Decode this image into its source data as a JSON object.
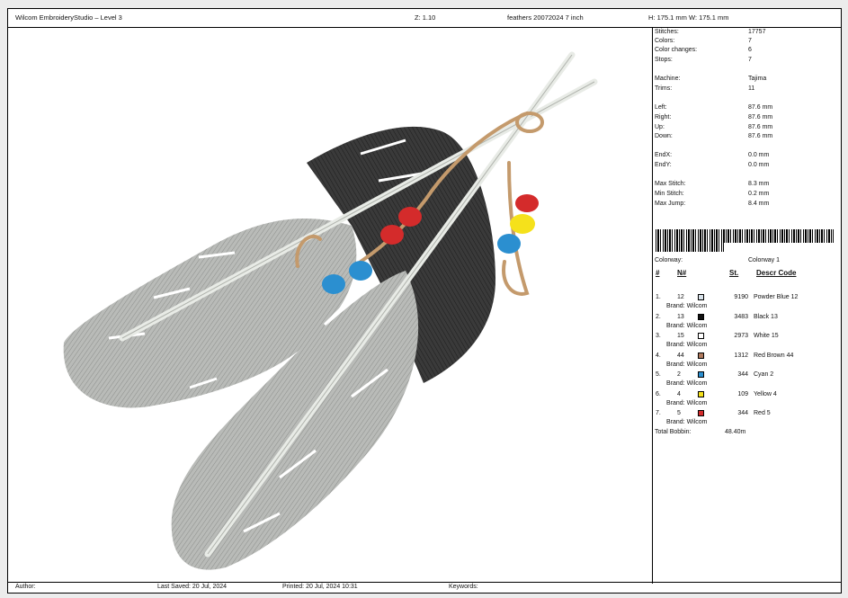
{
  "header": {
    "app_title": "Wilcom EmbroideryStudio – Level 3",
    "zoom": "Z: 1.10",
    "design_name": "feathers 20072024 7 inch",
    "size": "H: 175.1 mm   W: 175.1 mm"
  },
  "stats": {
    "stitches": {
      "label": "Stitches:",
      "value": "17757"
    },
    "colors": {
      "label": "Colors:",
      "value": "7"
    },
    "color_changes": {
      "label": "Color changes:",
      "value": "6"
    },
    "stops": {
      "label": "Stops:",
      "value": "7"
    },
    "machine": {
      "label": "Machine:",
      "value": "Tajima"
    },
    "trims": {
      "label": "Trims:",
      "value": "11"
    },
    "left": {
      "label": "Left:",
      "value": "87.6 mm"
    },
    "right": {
      "label": "Right:",
      "value": "87.6 mm"
    },
    "up": {
      "label": "Up:",
      "value": "87.6 mm"
    },
    "down": {
      "label": "Down:",
      "value": "87.6 mm"
    },
    "endx": {
      "label": "EndX:",
      "value": "0.0 mm"
    },
    "endy": {
      "label": "EndY:",
      "value": "0.0 mm"
    },
    "max_stitch": {
      "label": "Max Stitch:",
      "value": "8.3 mm"
    },
    "min_stitch": {
      "label": "Min Stitch:",
      "value": "0.2 mm"
    },
    "max_jump": {
      "label": "Max Jump:",
      "value": "8.4 mm"
    }
  },
  "colorway": {
    "label": "Colorway:",
    "value": "Colorway 1"
  },
  "table": {
    "col_num": "#",
    "col_n": "N#",
    "col_st": "St.",
    "col_descr": "Descr  Code",
    "rows": [
      {
        "idx": "1.",
        "n": "12",
        "color": "#d8e2ea",
        "st": "9190",
        "descr": "Powder Blue 12",
        "brand": "Brand: Wilcom"
      },
      {
        "idx": "2.",
        "n": "13",
        "color": "#111111",
        "st": "3483",
        "descr": "Black 13",
        "brand": "Brand: Wilcom"
      },
      {
        "idx": "3.",
        "n": "15",
        "color": "#ffffff",
        "st": "2973",
        "descr": "White 15",
        "brand": "Brand: Wilcom"
      },
      {
        "idx": "4.",
        "n": "44",
        "color": "#b07a5e",
        "st": "1312",
        "descr": "Red Brown 44",
        "brand": "Brand: Wilcom"
      },
      {
        "idx": "5.",
        "n": "2",
        "color": "#2b8fd0",
        "st": "344",
        "descr": "Cyan 2",
        "brand": "Brand: Wilcom"
      },
      {
        "idx": "6.",
        "n": "4",
        "color": "#f5e11b",
        "st": "109",
        "descr": "Yellow 4",
        "brand": "Brand: Wilcom"
      },
      {
        "idx": "7.",
        "n": "5",
        "color": "#d42b2b",
        "st": "344",
        "descr": "Red 5",
        "brand": "Brand: Wilcom"
      }
    ],
    "total_bobbin_label": "Total Bobbin:",
    "total_bobbin_value": "48.40m"
  },
  "footer": {
    "author": "Author:",
    "last_saved": "Last Saved: 20 Jul, 2024",
    "printed": "Printed: 20 Jul, 2024 10:31",
    "keywords": "Keywords:"
  }
}
